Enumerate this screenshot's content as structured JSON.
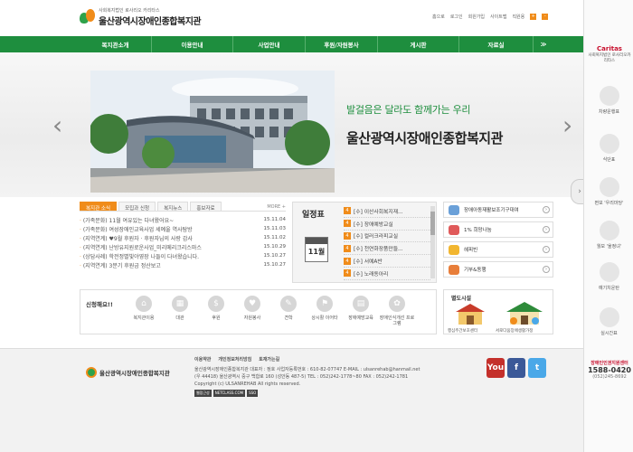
{
  "header": {
    "logo_sub": "사회복지법인 로사리오 카리타스",
    "logo_name": "울산광역시장애인종합복지관",
    "util": [
      "홈으로",
      "로그인",
      "회원가입",
      "사이트맵",
      "직원용"
    ]
  },
  "nav": [
    "복지관소개",
    "이용안내",
    "사업안내",
    "후원/자원봉사",
    "게시판",
    "자료실",
    "≫"
  ],
  "banner": {
    "slogan": "발걸음은 달라도 함께가는 우리",
    "title": "울산광역시장애인종합복지관"
  },
  "news": {
    "tabs": [
      "복지관 소식",
      "모집과 신청",
      "복지뉴스",
      "홍보자료"
    ],
    "more": "MORE +",
    "items": [
      {
        "title": "(가족문화) 11월 여유있는 다녀왔어요~",
        "date": "15.11.04"
      },
      {
        "title": "(가족문화) 여성장애인교육사업 세예울 역사탐방",
        "date": "15.11.03"
      },
      {
        "title": "(지역연계) ♥9월 후원자 · 후원자님의 사랑 감사",
        "date": "15.11.02"
      },
      {
        "title": "(지역연계) 난방유지원로운사업_미리메리크리스마스",
        "date": "15.10.29"
      },
      {
        "title": "(상담사례) 학전정별빛야영장 나들이 다녀왔습니다.",
        "date": "15.10.27"
      },
      {
        "title": "(지역연계) 3분기 후원금 정산보고",
        "date": "15.10.27"
      }
    ]
  },
  "schedule": {
    "title": "일정표",
    "month": "11월",
    "items": [
      {
        "n": "4",
        "text": "[수] 이산사회복지재..."
      },
      {
        "n": "4",
        "text": "[수] 장애예방교실"
      },
      {
        "n": "4",
        "text": "[수] 컬러크라피교실"
      },
      {
        "n": "4",
        "text": "[수] 천연화장품만들..."
      },
      {
        "n": "4",
        "text": "[수] 서예A반"
      },
      {
        "n": "4",
        "text": "[수] 노래동아리"
      }
    ]
  },
  "quick": [
    {
      "label": "장애아동재활보조기구대여",
      "color": "#6aa0d8"
    },
    {
      "label": "1% 희망나눔",
      "color": "#e05a5a"
    },
    {
      "label": "헤피빈",
      "color": "#f2b630"
    },
    {
      "label": "기부&동행",
      "color": "#e87e3a"
    }
  ],
  "apply": {
    "label": "신청해요!!",
    "items": [
      "복지관이용",
      "대관",
      "후원",
      "자원봉사",
      "견학",
      "상시활 이어타",
      "장애예방교육",
      "장애인식개선 프로그램"
    ]
  },
  "facilities": {
    "label": "별도시설",
    "items": [
      "행심주간보호센터",
      "서로다움장애생활가정"
    ]
  },
  "footer": {
    "logo": "울산광역시장애인종합복지관",
    "links": [
      "이용약관",
      "개인정보처리방침",
      "토재가는길"
    ],
    "lines": [
      "울산광역시장애인종합복지관   대표자 : 정호   사업자등록번호 : 610-82-07747   E-MAIL : ulsanrehab@hanmail.net",
      "(우 44418) 울산광역시 중구 백합로 160 (성안동 487-5)   TEL : 052)242-1778~80   FAX : 052)242-1781",
      "Copyright (c) ULSANREHAB  All rights reserved."
    ],
    "badges": [
      "웹접근성",
      "NETCLASS.COM",
      "SSO"
    ]
  },
  "social": [
    {
      "name": "YouTube",
      "label": "You",
      "color": "#c4302b"
    },
    {
      "name": "Facebook",
      "label": "f",
      "color": "#3b5998"
    },
    {
      "name": "Twitter",
      "label": "t",
      "color": "#4aa8e8"
    }
  ],
  "side": {
    "brand": "Caritas",
    "brand_sub": "사회복지법인 로사리오카리타스",
    "items": [
      "차량운행표",
      "식단표",
      "편보 '우리마당'",
      "월보 '울정녀'",
      "예기치운탄",
      "실시간표"
    ],
    "phone_label": "장애인인권지원센터",
    "phone": "1588-0420",
    "phone_sub": "(052)245-8692"
  }
}
